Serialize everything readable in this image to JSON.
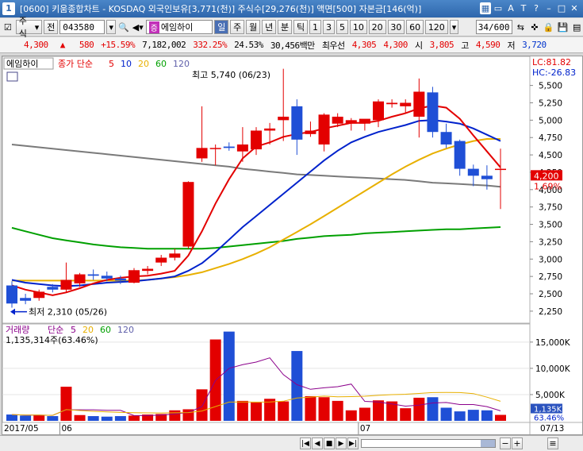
{
  "title": {
    "app_num": "1",
    "text": "[0600] 키움종합차트 - KOSDAQ 외국인보유[3,771(천)] 주식수[29,276(천)] 액면[500] 자본금[146(억)]"
  },
  "toolbar": {
    "market": "주식",
    "prev_label": "전",
    "code": "043580",
    "name_tag": "증",
    "name": "에임하이",
    "periods": [
      "일",
      "주",
      "월",
      "년",
      "분",
      "틱",
      "1",
      "3",
      "5",
      "10",
      "20",
      "30",
      "60",
      "120"
    ],
    "page": "34/600"
  },
  "pricebar": {
    "price": "4,300",
    "change": "580",
    "change_pct": "+15.59%",
    "volume": "7,182,002",
    "vol_ratio": "332.25%",
    "turnover": "24.53%",
    "amount": "30,456백만",
    "order_label": "최우선",
    "best_ask": "4,305",
    "best_bid": "4,300",
    "open_label": "시",
    "open": "3,805",
    "high_label": "고",
    "high": "4,590",
    "low_label": "저",
    "low": "3,720"
  },
  "chart_data": {
    "type": "candlestick",
    "stock_label": "에임하이",
    "legend_main": {
      "label": "종가 단순",
      "periods": [
        "5",
        "10",
        "20",
        "60",
        "120"
      ],
      "colors": [
        "#e30000",
        "#0022cc",
        "#e8b000",
        "#00a000",
        "#6060aa"
      ]
    },
    "lc_label": "LC:81.82",
    "hc_label": "HC:-26.83",
    "high_annotation": "최고 5,740 (06/23)",
    "low_annotation": "최저 2,310 (05/26)",
    "current_price": "4,200",
    "current_pct": "1.69%",
    "price_axis": {
      "min": 2100,
      "max": 5850,
      "ticks": [
        "5,500",
        "5,250",
        "5,000",
        "4,750",
        "4,500",
        "4,250",
        "4,000",
        "3,750",
        "3,500",
        "3,250",
        "3,000",
        "2,750",
        "2,500",
        "2,250"
      ],
      "tick_values": [
        5500,
        5250,
        5000,
        4750,
        4500,
        4250,
        4000,
        3750,
        3500,
        3250,
        3000,
        2750,
        2500,
        2250
      ]
    },
    "candles": [
      {
        "o": 2620,
        "h": 2680,
        "l": 2300,
        "c": 2360
      },
      {
        "o": 2440,
        "h": 2500,
        "l": 2350,
        "c": 2400
      },
      {
        "o": 2440,
        "h": 2560,
        "l": 2400,
        "c": 2530
      },
      {
        "o": 2600,
        "h": 2640,
        "l": 2520,
        "c": 2560
      },
      {
        "o": 2560,
        "h": 2950,
        "l": 2520,
        "c": 2700
      },
      {
        "o": 2650,
        "h": 2800,
        "l": 2600,
        "c": 2780
      },
      {
        "o": 2780,
        "h": 2850,
        "l": 2700,
        "c": 2760
      },
      {
        "o": 2760,
        "h": 2820,
        "l": 2680,
        "c": 2720
      },
      {
        "o": 2720,
        "h": 2760,
        "l": 2640,
        "c": 2690
      },
      {
        "o": 2660,
        "h": 2870,
        "l": 2650,
        "c": 2840
      },
      {
        "o": 2830,
        "h": 2900,
        "l": 2780,
        "c": 2860
      },
      {
        "o": 2950,
        "h": 3060,
        "l": 2900,
        "c": 3020
      },
      {
        "o": 3020,
        "h": 3150,
        "l": 2980,
        "c": 3080
      },
      {
        "o": 3180,
        "h": 4120,
        "l": 3150,
        "c": 4110
      },
      {
        "o": 4450,
        "h": 5200,
        "l": 4400,
        "c": 4600
      },
      {
        "o": 4600,
        "h": 4650,
        "l": 4350,
        "c": 4600
      },
      {
        "o": 4620,
        "h": 4680,
        "l": 4560,
        "c": 4600
      },
      {
        "o": 4550,
        "h": 4900,
        "l": 4400,
        "c": 4650
      },
      {
        "o": 4580,
        "h": 4900,
        "l": 4500,
        "c": 4850
      },
      {
        "o": 4850,
        "h": 4960,
        "l": 4650,
        "c": 4880
      },
      {
        "o": 5000,
        "h": 5740,
        "l": 4700,
        "c": 5050
      },
      {
        "o": 5200,
        "h": 5300,
        "l": 4500,
        "c": 4720
      },
      {
        "o": 4800,
        "h": 4980,
        "l": 4760,
        "c": 4850
      },
      {
        "o": 4650,
        "h": 5100,
        "l": 4550,
        "c": 5080
      },
      {
        "o": 4950,
        "h": 5100,
        "l": 4900,
        "c": 5050
      },
      {
        "o": 4950,
        "h": 5030,
        "l": 4850,
        "c": 5000
      },
      {
        "o": 4950,
        "h": 5000,
        "l": 4850,
        "c": 5020
      },
      {
        "o": 5000,
        "h": 5300,
        "l": 4900,
        "c": 5270
      },
      {
        "o": 5230,
        "h": 5300,
        "l": 5180,
        "c": 5250
      },
      {
        "o": 5200,
        "h": 5300,
        "l": 5100,
        "c": 5250
      },
      {
        "o": 5050,
        "h": 5600,
        "l": 4750,
        "c": 5410
      },
      {
        "o": 5400,
        "h": 5480,
        "l": 4750,
        "c": 4830
      },
      {
        "o": 4830,
        "h": 4950,
        "l": 4600,
        "c": 4650
      },
      {
        "o": 4700,
        "h": 4720,
        "l": 4200,
        "c": 4300
      },
      {
        "o": 4300,
        "h": 4360,
        "l": 4050,
        "c": 4200
      },
      {
        "o": 4200,
        "h": 4350,
        "l": 4000,
        "c": 4150
      },
      {
        "o": 4300,
        "h": 4590,
        "l": 3720,
        "c": 4300
      }
    ],
    "ma_lines": [
      {
        "name": "5",
        "color": "#e30000",
        "values": [
          2620,
          2560,
          2520,
          2480,
          2520,
          2580,
          2650,
          2700,
          2730,
          2750,
          2760,
          2790,
          2830,
          3050,
          3400,
          3800,
          4150,
          4450,
          4620,
          4680,
          4760,
          4800,
          4830,
          4880,
          4920,
          4960,
          4960,
          4990,
          5050,
          5100,
          5170,
          5210,
          5180,
          5020,
          4780,
          4550,
          4320
        ]
      },
      {
        "name": "10",
        "color": "#0022cc",
        "values": [
          2700,
          2660,
          2640,
          2620,
          2610,
          2620,
          2640,
          2660,
          2670,
          2680,
          2700,
          2720,
          2750,
          2830,
          2940,
          3100,
          3280,
          3460,
          3620,
          3780,
          3940,
          4100,
          4260,
          4420,
          4560,
          4680,
          4760,
          4830,
          4880,
          4930,
          4990,
          5000,
          4980,
          4950,
          4880,
          4790,
          4700
        ]
      },
      {
        "name": "20",
        "color": "#e8b000",
        "values": [
          2690,
          2690,
          2690,
          2690,
          2690,
          2690,
          2690,
          2690,
          2690,
          2690,
          2700,
          2720,
          2740,
          2770,
          2810,
          2870,
          2930,
          3000,
          3080,
          3170,
          3280,
          3390,
          3500,
          3620,
          3740,
          3860,
          3980,
          4100,
          4220,
          4330,
          4430,
          4520,
          4590,
          4650,
          4700,
          4730,
          4730
        ]
      },
      {
        "name": "60",
        "color": "#00a000",
        "values": [
          3450,
          3400,
          3350,
          3300,
          3270,
          3240,
          3210,
          3190,
          3170,
          3160,
          3150,
          3150,
          3150,
          3150,
          3150,
          3160,
          3180,
          3200,
          3220,
          3240,
          3260,
          3290,
          3310,
          3330,
          3340,
          3350,
          3370,
          3380,
          3390,
          3400,
          3410,
          3420,
          3430,
          3430,
          3440,
          3450,
          3460
        ]
      },
      {
        "name": "120",
        "color": "#7a7a7a",
        "values": [
          4650,
          4630,
          4610,
          4590,
          4570,
          4550,
          4530,
          4510,
          4490,
          4470,
          4450,
          4430,
          4410,
          4390,
          4370,
          4350,
          4330,
          4300,
          4280,
          4260,
          4240,
          4220,
          4210,
          4200,
          4190,
          4180,
          4170,
          4160,
          4150,
          4140,
          4120,
          4100,
          4090,
          4080,
          4070,
          4060,
          4040
        ]
      }
    ],
    "volume": {
      "label": "거래량",
      "legend_periods": [
        "5",
        "20",
        "60",
        "120"
      ],
      "legend_colors": [
        "#8b008b",
        "#e8b000",
        "#00a000",
        "#6060aa"
      ],
      "current": "1,135,314주(63.46%)",
      "axis_max": 18000,
      "ticks": [
        "15,000K",
        "10,000K",
        "5,000K"
      ],
      "tick_values": [
        15000,
        10000,
        5000
      ],
      "current_label": "1,135K",
      "current_pct": "63.46%",
      "values": [
        1200,
        1000,
        1100,
        900,
        6500,
        1100,
        900,
        800,
        900,
        1000,
        1200,
        1300,
        2000,
        2200,
        6000,
        15500,
        17000,
        3800,
        3500,
        4200,
        3700,
        13300,
        4700,
        4500,
        3800,
        2000,
        2500,
        3900,
        3700,
        2400,
        4400,
        4500,
        2500,
        1800,
        2100,
        2000,
        1135
      ],
      "ma5": [
        1200,
        1100,
        1100,
        1050,
        2100,
        2100,
        2100,
        2000,
        2000,
        1000,
        1000,
        1100,
        1300,
        1600,
        2700,
        7700,
        10000,
        10700,
        11200,
        12000,
        8800,
        6900,
        6000,
        6300,
        6500,
        7000,
        3700,
        3600,
        3200,
        2800,
        3000,
        3400,
        3500,
        3100,
        3100,
        2700,
        1900
      ]
    },
    "x_axis": {
      "labels": [
        "2017/05",
        "06",
        "07",
        "07/13"
      ],
      "label_indices": [
        0,
        4,
        26,
        36
      ]
    }
  },
  "bottom_bar": {
    "nav_buttons": [
      "|◀",
      "◀",
      "■",
      "▶",
      "▶|"
    ],
    "zoom_minus": "−",
    "zoom_plus": "+",
    "chart_icon": "≡"
  }
}
